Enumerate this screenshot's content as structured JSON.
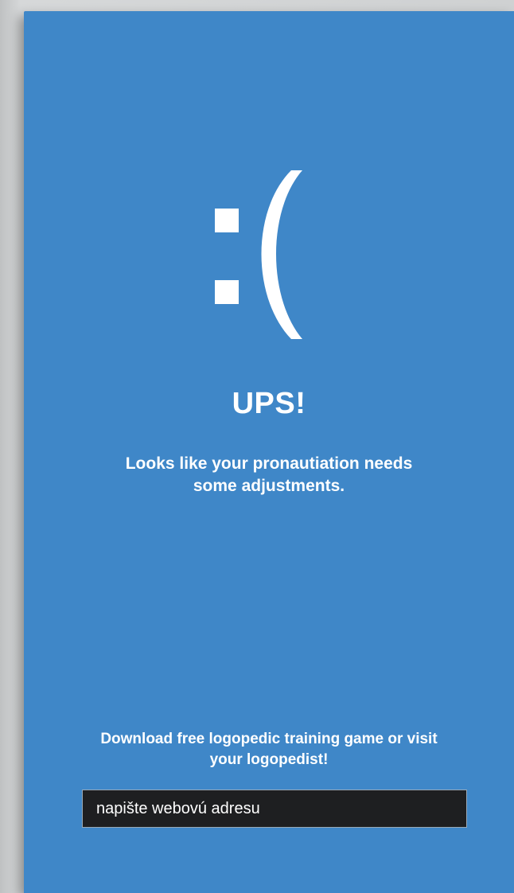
{
  "error_screen": {
    "icon": "sad-face-emoticon",
    "emoticon_text": ":(",
    "title": "UPS!",
    "message": "Looks like your pronautiation needs some adjustments.",
    "download_prompt": "Download free logopedic training game or visit your logopedist!",
    "address_input": {
      "value": "",
      "placeholder": "napište webovú adresu"
    }
  },
  "colors": {
    "panel_background": "#3f87c8",
    "text": "#ffffff",
    "input_background": "#1e1f21"
  }
}
